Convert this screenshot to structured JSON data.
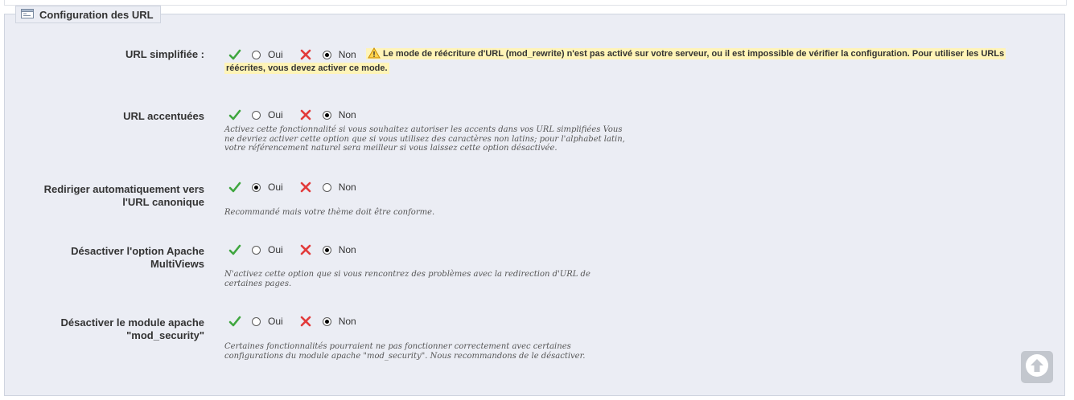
{
  "section": {
    "title": "Configuration des URL"
  },
  "options_labels": {
    "yes": "Oui",
    "no": "Non"
  },
  "rows": [
    {
      "label": "URL simplifiée :",
      "selected": "no",
      "warning_line1": "Le mode de réécriture d'URL (mod_rewrite) n'est pas activé sur votre serveur, ou il est impossible de vérifier la configuration. Pour utiliser les URLs",
      "warning_line2": "réécrites, vous devez activer ce mode."
    },
    {
      "label": "URL accentuées",
      "selected": "no",
      "hint": "Activez cette fonctionnalité si vous souhaitez autoriser les accents dans vos URL simplifiées Vous ne devriez activer cette option que si vous utilisez des caractères non latins; pour l'alphabet latin, votre référencement naturel sera meilleur si vous laissez cette option désactivée."
    },
    {
      "label_line1": "Rediriger automatiquement vers",
      "label_line2": "l'URL canonique",
      "selected": "yes",
      "hint": "Recommandé mais votre thème doit être conforme."
    },
    {
      "label_line1": "Désactiver l'option Apache",
      "label_line2": "MultiViews",
      "selected": "no",
      "hint": "N'activez cette option que si vous rencontrez des problèmes avec la redirection d'URL de certaines pages."
    },
    {
      "label_line1": "Désactiver le module apache",
      "label_line2": "\"mod_security\"",
      "selected": "no",
      "hint": "Certaines fonctionnalités pourraient ne pas fonctionner correctement avec certaines configurations du module apache \"mod_security\". Nous recommandons de le désactiver."
    }
  ],
  "icons": {
    "yes": "check-icon",
    "no": "cross-icon",
    "warning": "warning-icon",
    "legend": "settings-window-icon",
    "scroll_top": "arrow-up-icon"
  },
  "colors": {
    "yes": "#3fa63f",
    "no": "#e23b3b",
    "warning_bg": "#fff4b7",
    "panel_bg": "#ebedf4"
  }
}
